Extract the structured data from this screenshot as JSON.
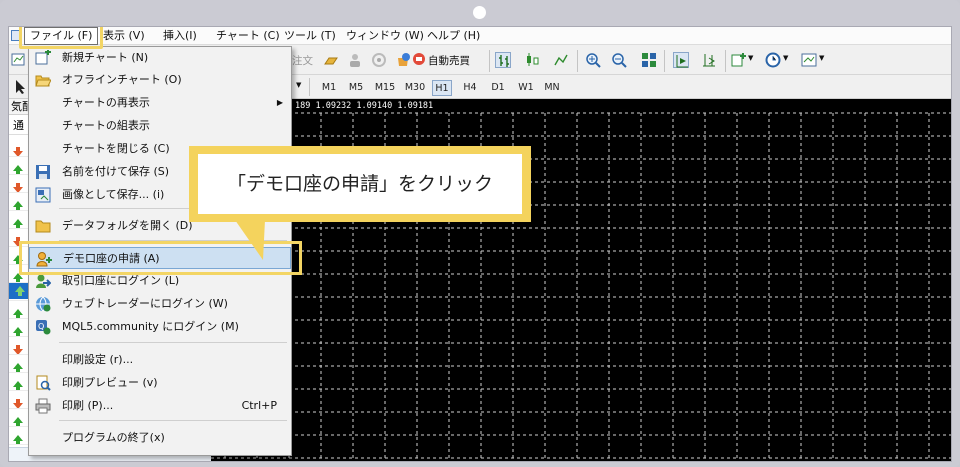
{
  "menubar": {
    "file": "ファイル (F)",
    "view": "表示 (V)",
    "insert": "挿入(I)",
    "chart": "チャート (C)",
    "tools": "ツール (T)",
    "window": "ウィンドウ (W)",
    "help": "ヘルプ (H)"
  },
  "toolbar": {
    "order_label": "注文",
    "autotrade_label": "自動売買"
  },
  "timeframes": [
    "M1",
    "M5",
    "M15",
    "M30",
    "H1",
    "H4",
    "D1",
    "W1",
    "MN"
  ],
  "active_timeframe": "H1",
  "left_panel": {
    "header": "気配",
    "tab": "通"
  },
  "chart_info": "189 1.09232 1.09140 1.09181",
  "file_menu": {
    "items": [
      {
        "label": "新規チャート (N)",
        "icon": "new-chart-icon"
      },
      {
        "label": "オフラインチャート (O)",
        "icon": "folder-open-icon"
      },
      {
        "label": "チャートの再表示",
        "icon": "",
        "submenu": "▶"
      },
      {
        "label": "チャートの組表示",
        "icon": ""
      },
      {
        "label": "チャートを閉じる (C)",
        "icon": ""
      },
      {
        "label": "名前を付けて保存 (S)",
        "icon": "save-icon"
      },
      {
        "label": "画像として保存... (i)",
        "icon": "save-picture-icon"
      },
      {
        "label": "データフォルダを開く (D)",
        "icon": "folder-icon"
      },
      {
        "label": "デモ口座の申請 (A)",
        "icon": "demo-account-icon"
      },
      {
        "label": "取引口座にログイン (L)",
        "icon": "login-icon"
      },
      {
        "label": "ウェブトレーダーにログイン (W)",
        "icon": "webtrader-icon"
      },
      {
        "label": "MQL5.community にログイン (M)",
        "icon": "mql5-icon"
      },
      {
        "label": "印刷設定 (r)...",
        "icon": ""
      },
      {
        "label": "印刷プレビュー (v)",
        "icon": "print-preview-icon"
      },
      {
        "label": "印刷 (P)...",
        "icon": "print-icon",
        "shortcut": "Ctrl+P"
      },
      {
        "label": "プログラムの終了(x)",
        "icon": ""
      }
    ]
  },
  "callout": {
    "text": "「デモ口座の申請」をクリック"
  },
  "colors": {
    "highlight": "#f3d564",
    "selected_item": "#cde0f2",
    "up_arrow": "#2fa52f",
    "down_arrow": "#e0582a"
  }
}
